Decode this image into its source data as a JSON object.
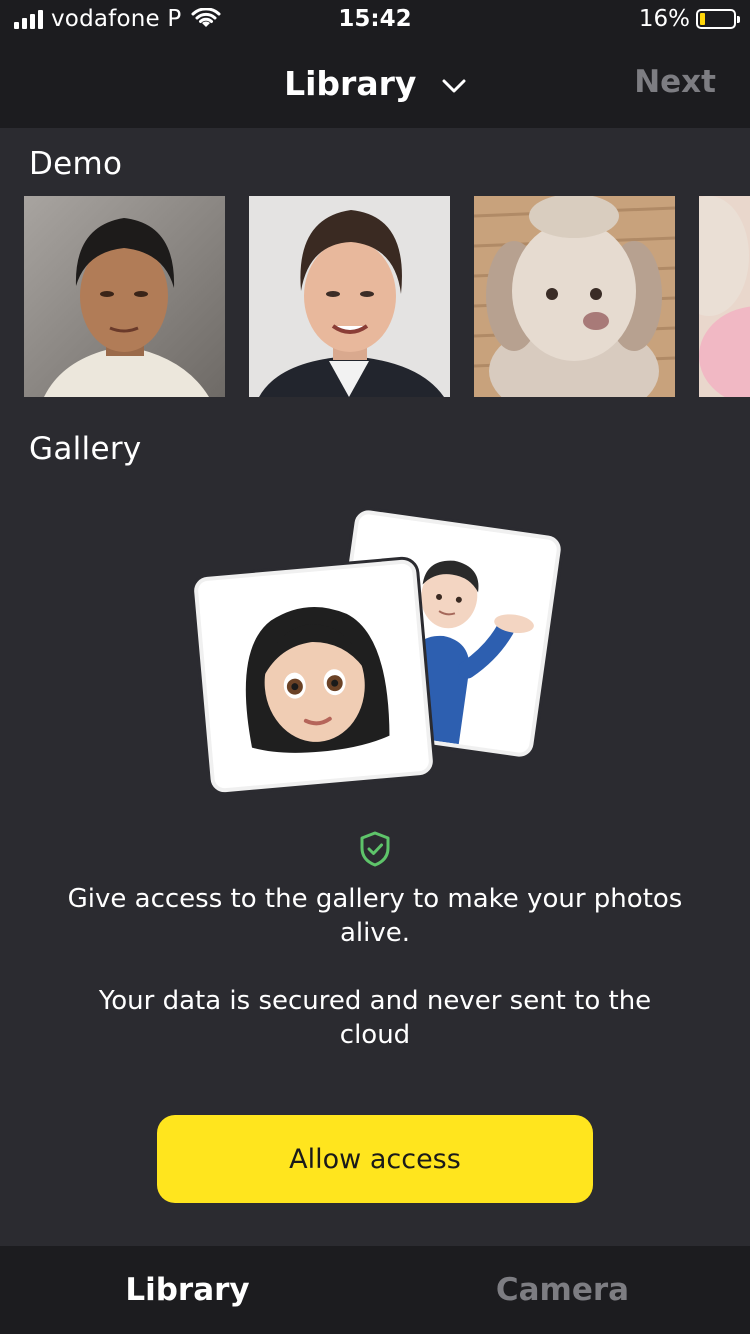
{
  "status_bar": {
    "carrier": "vodafone P",
    "time": "15:42",
    "battery_percent": "16%",
    "battery_level": 0.16
  },
  "header": {
    "title": "Library",
    "next_label": "Next"
  },
  "demo": {
    "title": "Demo",
    "photos": [
      "portrait-man-white-shirt",
      "portrait-man-dark-suit",
      "fluffy-dog",
      "partial-photo"
    ]
  },
  "gallery": {
    "title": "Gallery",
    "message_primary": "Give access to the gallery to make your photos alive.",
    "message_secondary": "Your data is secured and never sent to the cloud",
    "allow_label": "Allow access"
  },
  "tabs": {
    "library": "Library",
    "camera": "Camera"
  },
  "colors": {
    "accent": "#ffe51e",
    "background": "#2b2b30",
    "bar": "#1c1c1f",
    "inactive": "#7d7d82",
    "shield": "#5ec46a"
  }
}
